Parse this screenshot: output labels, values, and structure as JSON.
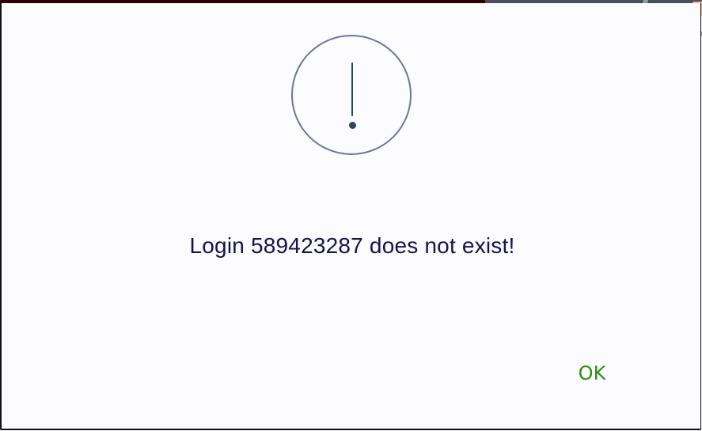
{
  "dialog": {
    "message": "Login 589423287 does not exist!",
    "button_label": "OK",
    "icon": "exclamation-circle-icon"
  },
  "colors": {
    "background": "#fcfbfe",
    "text": "#16124d",
    "icon_ring": "#6b76a2",
    "icon_mark": "#244a5f",
    "button_text": "#2a8f12",
    "top_strip_left": "#2a0202",
    "top_strip_right": "#4a4f58",
    "bg_ring": "#8aa8a3",
    "bg_accent": "#f0b1a4"
  }
}
